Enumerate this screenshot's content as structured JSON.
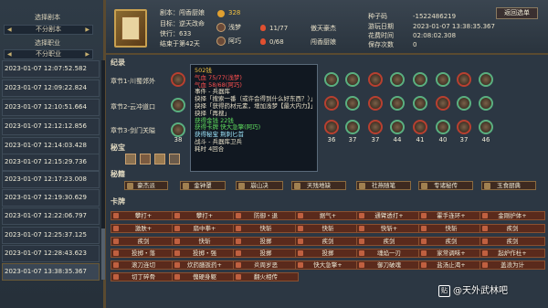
{
  "sidebar": {
    "select_script_label": "选择剧本",
    "script_value": "不分剧本",
    "select_job_label": "选择职业",
    "job_value": "不分职业",
    "entries": [
      "2023-01-07 12:07:52.582",
      "2023-01-07 12:09:22.824",
      "2023-01-07 12:10:51.664",
      "2023-01-07 12:12:12.856",
      "2023-01-07 12:14:03.428",
      "2023-01-07 12:15:29.736",
      "2023-01-07 12:17:23.008",
      "2023-01-07 12:19:30.629",
      "2023-01-07 12:22:06.797",
      "2023-01-07 12:25:37.125",
      "2023-01-07 12:28:43.623",
      "2023-01-07 13:38:35.367"
    ]
  },
  "header": {
    "coin_value": "328",
    "script_line": "剧本：闯香厨娘",
    "status_line": "目标：逆天改命",
    "reputation_line": "侠行：633",
    "ending_line": "结束于第42天",
    "char1_name": "浅梦",
    "char2_name": "阿巧",
    "stat1": "11/77",
    "stat2": "0/68",
    "title1": "傲天豪杰",
    "title2": "闯香厨娘",
    "seed_label": "种子码",
    "seed_value": "-1522486219",
    "time_label": "游玩日期",
    "time_value": "2023-01-07 13:38:35.367",
    "duration_label": "花费时间",
    "duration_value": "02:08:02.308",
    "restart_label": "保存次数",
    "restart_value": "0",
    "back_button": "返回选单"
  },
  "records": {
    "title": "纪录",
    "chapters": [
      "章节1-川蜀郊外",
      "章节2-云冲道口",
      "章节3-剑门关隘"
    ],
    "row3_numbers": [
      "38",
      "36",
      "37",
      "37",
      "44",
      "41",
      "40",
      "37",
      "46"
    ]
  },
  "tooltip": {
    "lines": [
      "502钱",
      "气血 75/77(浅梦)",
      "气血 58/68(阿巧)",
      "事件 - 兵器库",
      "抉择「搜索一番（或许会得到什么好东西？）」",
      "抉择「获得药材元素，增加浅梦【最大内力】」",
      "抉择「再搜」",
      "获得金钱 22钱",
      "获得卡牌 快大急擎(阿巧)",
      "获得秘宝 荆刺匕首",
      "战斗 - 兵器库卫兵",
      "耗时 4回合"
    ]
  },
  "treasures": {
    "title": "秘宝"
  },
  "secrets": {
    "title": "秘籍",
    "items": [
      "豪杰派",
      "金钟罩",
      "崩山决",
      "天残地缺",
      "社燕随笔",
      "专诸秘传",
      "玉食厨典"
    ]
  },
  "cards": {
    "title": "卡牌",
    "items": [
      "攀打+",
      "攀打+",
      "防御・退",
      "据气+",
      "通臂透打+",
      "霍手连环+",
      "金刚护体+",
      "激肤+",
      "扇中拳+",
      "快斩",
      "快斩",
      "快斩+",
      "快斩",
      "疾剑",
      "疾剑",
      "快斩",
      "投掷",
      "疾剑",
      "疾剑",
      "疾剑",
      "疾剑",
      "投掷・落",
      "投掷・强",
      "投掷",
      "投掷",
      "魂焰一刃",
      "家常调味+",
      "起炉作杜+",
      "滚刀连切",
      "炊药膳扳药+",
      "炎周岁恶",
      "快大急擎+",
      "御刀破魂",
      "盐汤止渴+",
      "盖浪为计",
      "切丁碎骨",
      "傀硬身躯",
      "翻火相传"
    ]
  },
  "watermark": {
    "text": "@天外武林吧",
    "badge": "贴"
  }
}
